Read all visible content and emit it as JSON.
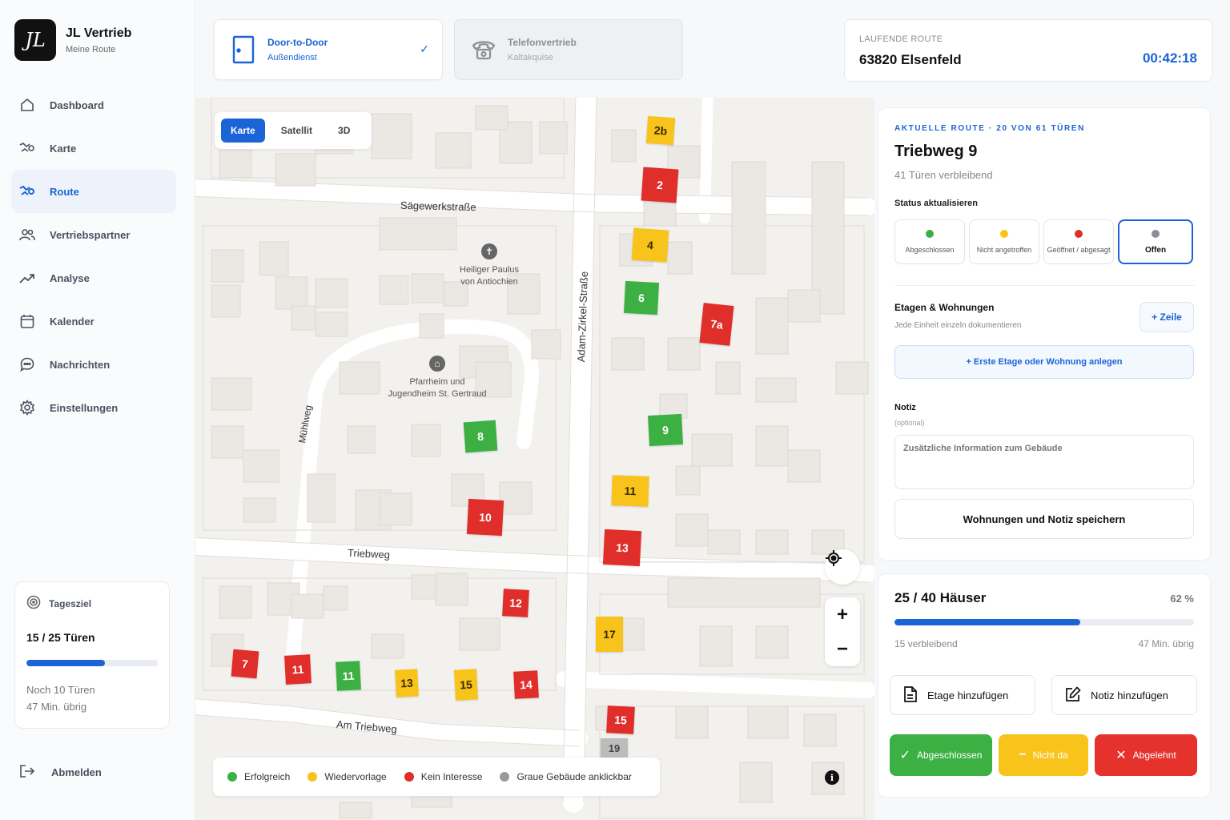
{
  "brand": {
    "logo": "JL",
    "title": "JL Vertrieb",
    "subtitle": "Meine Route"
  },
  "nav": [
    {
      "label": "Dashboard",
      "icon": "home-icon"
    },
    {
      "label": "Karte",
      "icon": "map-icon"
    },
    {
      "label": "Route",
      "icon": "route-icon",
      "active": true
    },
    {
      "label": "Vertriebspartner",
      "icon": "users-icon"
    },
    {
      "label": "Analyse",
      "icon": "trend-icon"
    },
    {
      "label": "Kalender",
      "icon": "calendar-icon"
    },
    {
      "label": "Nachrichten",
      "icon": "chat-icon"
    },
    {
      "label": "Einstellungen",
      "icon": "gear-icon"
    }
  ],
  "daily_goal": {
    "title": "Tagesziel",
    "count": "15 / 25 Türen",
    "progress": 0.6,
    "remaining": "Noch 10 Türen",
    "time_left": "47 Min. übrig"
  },
  "logout": "Abmelden",
  "modes": {
    "door": {
      "title": "Door-to-Door",
      "subtitle": "Außendienst",
      "selected": true
    },
    "phone": {
      "title": "Telefonvertrieb",
      "subtitle": "Kaltakquise"
    }
  },
  "current_route": {
    "label": "LAUFENDE ROUTE",
    "name": "63820 Elsenfeld",
    "timer": "00:42:18"
  },
  "map": {
    "view_toggle": [
      "Karte",
      "Satellit",
      "3D"
    ],
    "active_view": "Karte",
    "streets": {
      "saegewerk": "Sägewerkstraße",
      "adam": "Adam-Zirkel-Straße",
      "muehl": "Mühlweg",
      "trieb": "Triebweg",
      "am_trieb": "Am Triebweg"
    },
    "pois": {
      "church": {
        "line1": "Heiliger Paulus",
        "line2": "von Antiochien"
      },
      "parish": {
        "line1": "Pfarrheim und",
        "line2": "Jugendheim St. Gertraud"
      }
    },
    "houses": [
      "2b",
      "2",
      "4",
      "6",
      "7a",
      "8",
      "9",
      "11",
      "13",
      "10",
      "12",
      "17",
      "7",
      "11",
      "11",
      "13",
      "15",
      "14",
      "15",
      "19"
    ],
    "legend": {
      "success": "Erfolgreich",
      "followup": "Wiedervorlage",
      "no_interest": "Kein Interesse",
      "gray": "Graue Gebäude anklickbar"
    },
    "colors": {
      "green": "#3cb043",
      "yellow": "#f8c31a",
      "red": "#e02e2a",
      "gray": "#bcbcbc"
    }
  },
  "panel": {
    "kicker": "AKTUELLE ROUTE · 20 VON 61 TÜREN",
    "address": "Triebweg 9",
    "doors_left": "41 Türen verbleibend",
    "status_label": "Status aktualisieren",
    "statuses": [
      {
        "label": "Abgeschlossen",
        "color": "#3cb043"
      },
      {
        "label": "Nicht angetroffen",
        "color": "#f8c31a"
      },
      {
        "label": "Geöffnet / abgesagt",
        "color": "#e02e2a"
      },
      {
        "label": "Offen",
        "color": "#8a8f97",
        "selected": true
      }
    ],
    "floors_title": "Etagen & Wohnungen",
    "floors_sub": "Jede Einheit einzeln dokumentieren",
    "add_row": "+ Zeile",
    "first_floor": "+ Erste Etage oder Wohnung anlegen",
    "note_label": "Notiz",
    "note_optional": "(optional)",
    "note_placeholder": "Zusätzliche Information zum Gebäude",
    "save": "Wohnungen und Notiz speichern"
  },
  "progress": {
    "houses": "25 / 40 Häuser",
    "percent": "62 %",
    "fraction": 0.62,
    "remaining": "15 verbleibend",
    "time_left": "47 Min. übrig",
    "add_floor": "Etage hinzufügen",
    "add_note": "Notiz hinzufügen",
    "done": "Abgeschlossen",
    "absent": "Nicht da",
    "rejected": "Abgelehnt"
  }
}
